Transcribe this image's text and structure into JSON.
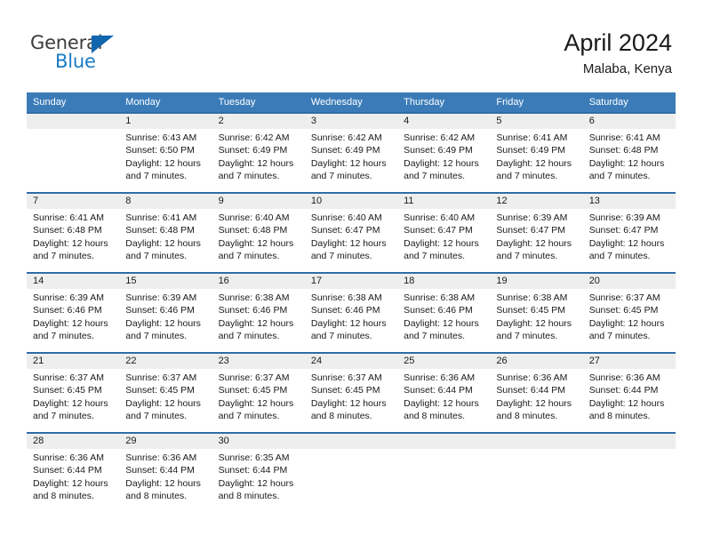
{
  "logo": {
    "word_one": "General",
    "word_two": "Blue",
    "triangle_icon": "blue-triangle-icon",
    "color_dark": "#3b3b3b",
    "color_blue": "#1a7bc4"
  },
  "header": {
    "title": "April 2024",
    "subtitle": "Malaba, Kenya"
  },
  "theme": {
    "header_blue": "#3b7cb8",
    "row_divider_blue": "#2f6da8",
    "daynum_band_gray": "#eeeeee",
    "text": "#1a1a1a"
  },
  "calendar": {
    "weekday_headers": [
      "Sunday",
      "Monday",
      "Tuesday",
      "Wednesday",
      "Thursday",
      "Friday",
      "Saturday"
    ],
    "weeks": [
      [
        {
          "day": "",
          "sunrise": "",
          "sunset": "",
          "daylight_1": "",
          "daylight_2": ""
        },
        {
          "day": "1",
          "sunrise": "Sunrise: 6:43 AM",
          "sunset": "Sunset: 6:50 PM",
          "daylight_1": "Daylight: 12 hours",
          "daylight_2": "and 7 minutes."
        },
        {
          "day": "2",
          "sunrise": "Sunrise: 6:42 AM",
          "sunset": "Sunset: 6:49 PM",
          "daylight_1": "Daylight: 12 hours",
          "daylight_2": "and 7 minutes."
        },
        {
          "day": "3",
          "sunrise": "Sunrise: 6:42 AM",
          "sunset": "Sunset: 6:49 PM",
          "daylight_1": "Daylight: 12 hours",
          "daylight_2": "and 7 minutes."
        },
        {
          "day": "4",
          "sunrise": "Sunrise: 6:42 AM",
          "sunset": "Sunset: 6:49 PM",
          "daylight_1": "Daylight: 12 hours",
          "daylight_2": "and 7 minutes."
        },
        {
          "day": "5",
          "sunrise": "Sunrise: 6:41 AM",
          "sunset": "Sunset: 6:49 PM",
          "daylight_1": "Daylight: 12 hours",
          "daylight_2": "and 7 minutes."
        },
        {
          "day": "6",
          "sunrise": "Sunrise: 6:41 AM",
          "sunset": "Sunset: 6:48 PM",
          "daylight_1": "Daylight: 12 hours",
          "daylight_2": "and 7 minutes."
        }
      ],
      [
        {
          "day": "7",
          "sunrise": "Sunrise: 6:41 AM",
          "sunset": "Sunset: 6:48 PM",
          "daylight_1": "Daylight: 12 hours",
          "daylight_2": "and 7 minutes."
        },
        {
          "day": "8",
          "sunrise": "Sunrise: 6:41 AM",
          "sunset": "Sunset: 6:48 PM",
          "daylight_1": "Daylight: 12 hours",
          "daylight_2": "and 7 minutes."
        },
        {
          "day": "9",
          "sunrise": "Sunrise: 6:40 AM",
          "sunset": "Sunset: 6:48 PM",
          "daylight_1": "Daylight: 12 hours",
          "daylight_2": "and 7 minutes."
        },
        {
          "day": "10",
          "sunrise": "Sunrise: 6:40 AM",
          "sunset": "Sunset: 6:47 PM",
          "daylight_1": "Daylight: 12 hours",
          "daylight_2": "and 7 minutes."
        },
        {
          "day": "11",
          "sunrise": "Sunrise: 6:40 AM",
          "sunset": "Sunset: 6:47 PM",
          "daylight_1": "Daylight: 12 hours",
          "daylight_2": "and 7 minutes."
        },
        {
          "day": "12",
          "sunrise": "Sunrise: 6:39 AM",
          "sunset": "Sunset: 6:47 PM",
          "daylight_1": "Daylight: 12 hours",
          "daylight_2": "and 7 minutes."
        },
        {
          "day": "13",
          "sunrise": "Sunrise: 6:39 AM",
          "sunset": "Sunset: 6:47 PM",
          "daylight_1": "Daylight: 12 hours",
          "daylight_2": "and 7 minutes."
        }
      ],
      [
        {
          "day": "14",
          "sunrise": "Sunrise: 6:39 AM",
          "sunset": "Sunset: 6:46 PM",
          "daylight_1": "Daylight: 12 hours",
          "daylight_2": "and 7 minutes."
        },
        {
          "day": "15",
          "sunrise": "Sunrise: 6:39 AM",
          "sunset": "Sunset: 6:46 PM",
          "daylight_1": "Daylight: 12 hours",
          "daylight_2": "and 7 minutes."
        },
        {
          "day": "16",
          "sunrise": "Sunrise: 6:38 AM",
          "sunset": "Sunset: 6:46 PM",
          "daylight_1": "Daylight: 12 hours",
          "daylight_2": "and 7 minutes."
        },
        {
          "day": "17",
          "sunrise": "Sunrise: 6:38 AM",
          "sunset": "Sunset: 6:46 PM",
          "daylight_1": "Daylight: 12 hours",
          "daylight_2": "and 7 minutes."
        },
        {
          "day": "18",
          "sunrise": "Sunrise: 6:38 AM",
          "sunset": "Sunset: 6:46 PM",
          "daylight_1": "Daylight: 12 hours",
          "daylight_2": "and 7 minutes."
        },
        {
          "day": "19",
          "sunrise": "Sunrise: 6:38 AM",
          "sunset": "Sunset: 6:45 PM",
          "daylight_1": "Daylight: 12 hours",
          "daylight_2": "and 7 minutes."
        },
        {
          "day": "20",
          "sunrise": "Sunrise: 6:37 AM",
          "sunset": "Sunset: 6:45 PM",
          "daylight_1": "Daylight: 12 hours",
          "daylight_2": "and 7 minutes."
        }
      ],
      [
        {
          "day": "21",
          "sunrise": "Sunrise: 6:37 AM",
          "sunset": "Sunset: 6:45 PM",
          "daylight_1": "Daylight: 12 hours",
          "daylight_2": "and 7 minutes."
        },
        {
          "day": "22",
          "sunrise": "Sunrise: 6:37 AM",
          "sunset": "Sunset: 6:45 PM",
          "daylight_1": "Daylight: 12 hours",
          "daylight_2": "and 7 minutes."
        },
        {
          "day": "23",
          "sunrise": "Sunrise: 6:37 AM",
          "sunset": "Sunset: 6:45 PM",
          "daylight_1": "Daylight: 12 hours",
          "daylight_2": "and 7 minutes."
        },
        {
          "day": "24",
          "sunrise": "Sunrise: 6:37 AM",
          "sunset": "Sunset: 6:45 PM",
          "daylight_1": "Daylight: 12 hours",
          "daylight_2": "and 8 minutes."
        },
        {
          "day": "25",
          "sunrise": "Sunrise: 6:36 AM",
          "sunset": "Sunset: 6:44 PM",
          "daylight_1": "Daylight: 12 hours",
          "daylight_2": "and 8 minutes."
        },
        {
          "day": "26",
          "sunrise": "Sunrise: 6:36 AM",
          "sunset": "Sunset: 6:44 PM",
          "daylight_1": "Daylight: 12 hours",
          "daylight_2": "and 8 minutes."
        },
        {
          "day": "27",
          "sunrise": "Sunrise: 6:36 AM",
          "sunset": "Sunset: 6:44 PM",
          "daylight_1": "Daylight: 12 hours",
          "daylight_2": "and 8 minutes."
        }
      ],
      [
        {
          "day": "28",
          "sunrise": "Sunrise: 6:36 AM",
          "sunset": "Sunset: 6:44 PM",
          "daylight_1": "Daylight: 12 hours",
          "daylight_2": "and 8 minutes."
        },
        {
          "day": "29",
          "sunrise": "Sunrise: 6:36 AM",
          "sunset": "Sunset: 6:44 PM",
          "daylight_1": "Daylight: 12 hours",
          "daylight_2": "and 8 minutes."
        },
        {
          "day": "30",
          "sunrise": "Sunrise: 6:35 AM",
          "sunset": "Sunset: 6:44 PM",
          "daylight_1": "Daylight: 12 hours",
          "daylight_2": "and 8 minutes."
        },
        {
          "day": "",
          "sunrise": "",
          "sunset": "",
          "daylight_1": "",
          "daylight_2": ""
        },
        {
          "day": "",
          "sunrise": "",
          "sunset": "",
          "daylight_1": "",
          "daylight_2": ""
        },
        {
          "day": "",
          "sunrise": "",
          "sunset": "",
          "daylight_1": "",
          "daylight_2": ""
        },
        {
          "day": "",
          "sunrise": "",
          "sunset": "",
          "daylight_1": "",
          "daylight_2": ""
        }
      ]
    ]
  }
}
